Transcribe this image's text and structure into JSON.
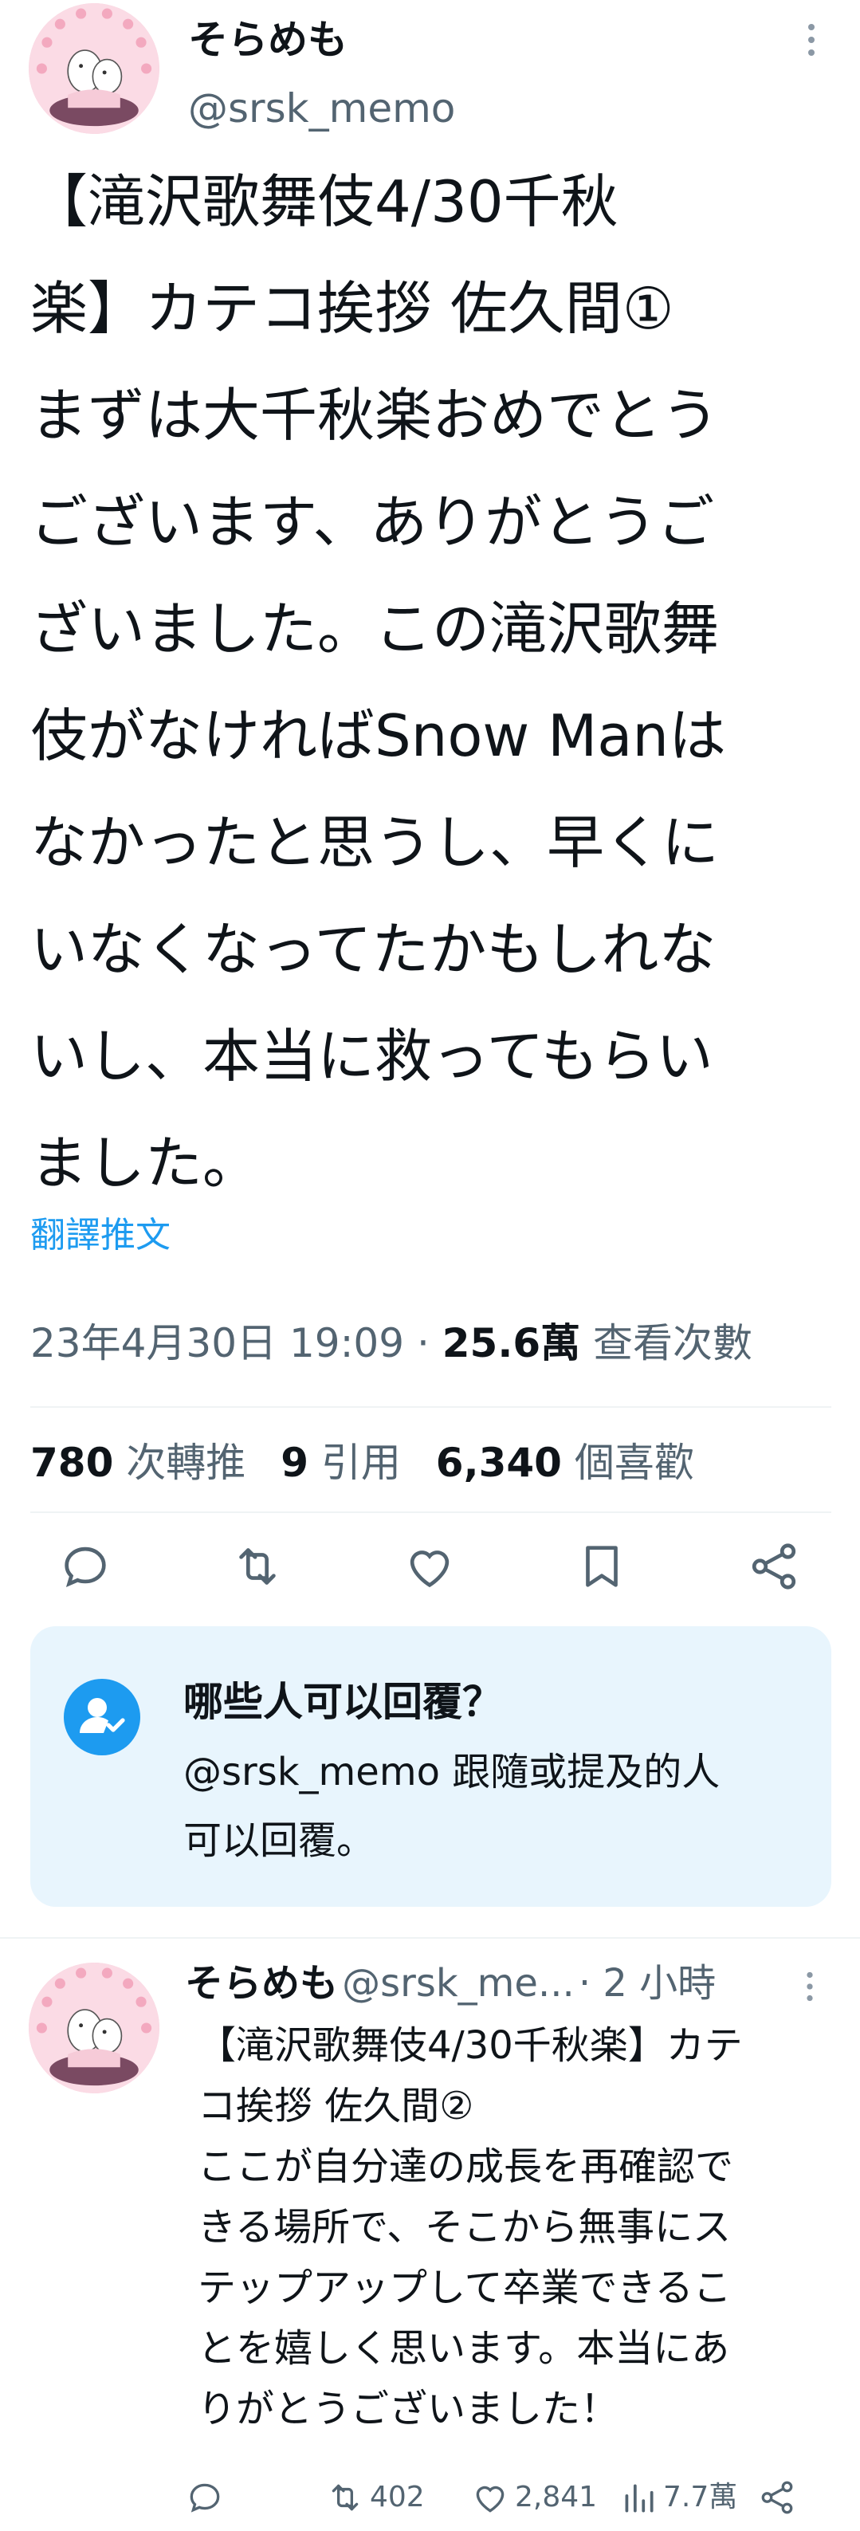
{
  "main_tweet": {
    "display_name": "そらめも",
    "handle": "@srsk_memo",
    "more_icon": "more-vertical-icon",
    "text_lines": [
      "【滝沢歌舞伎4/30千秋",
      "楽】カテコ挨拶 佐久間①",
      "まずは大千秋楽おめでとう",
      "ございます、ありがとうご",
      "ざいました。この滝沢歌舞",
      "伎がなければSnow Manは",
      "なかったと思うし、早くに",
      "いなくなってたかもしれな",
      "いし、本当に救ってもらい",
      "ました。"
    ],
    "translate_label": "翻譯推文",
    "timestamp": "23年4月30日 19:09",
    "views_count": "25.6萬",
    "views_label": "查看次數",
    "stats": {
      "retweets_count": "780",
      "retweets_label": "次轉推",
      "quotes_count": "9",
      "quotes_label": "引用",
      "likes_count": "6,340",
      "likes_label": "個喜歡"
    },
    "actions": [
      "reply-icon",
      "retweet-icon",
      "like-icon",
      "bookmark-icon",
      "share-icon"
    ]
  },
  "reply_restriction": {
    "title": "哪些人可以回覆？",
    "desc_line1": "@srsk_memo 跟隨或提及的人",
    "desc_line2": "可以回覆。"
  },
  "reply_tweet": {
    "display_name": "そらめも",
    "handle": "@srsk_me...",
    "time": "· 2 小時",
    "text_lines": [
      "【滝沢歌舞伎4/30千秋楽】カテ",
      "コ挨拶 佐久間②",
      "ここが自分達の成長を再確認で",
      "きる場所で、そこから無事にス",
      "テップアップして卒業できるこ",
      "とを嬉しく思います。本当にあ",
      "りがとうございました！"
    ],
    "retweets": "402",
    "likes": "2,841",
    "views": "7.7萬"
  },
  "colors": {
    "accent": "#1d9bf0",
    "text": "#0f1419",
    "muted": "#536471",
    "reply_box_bg": "#e8f5fd"
  }
}
